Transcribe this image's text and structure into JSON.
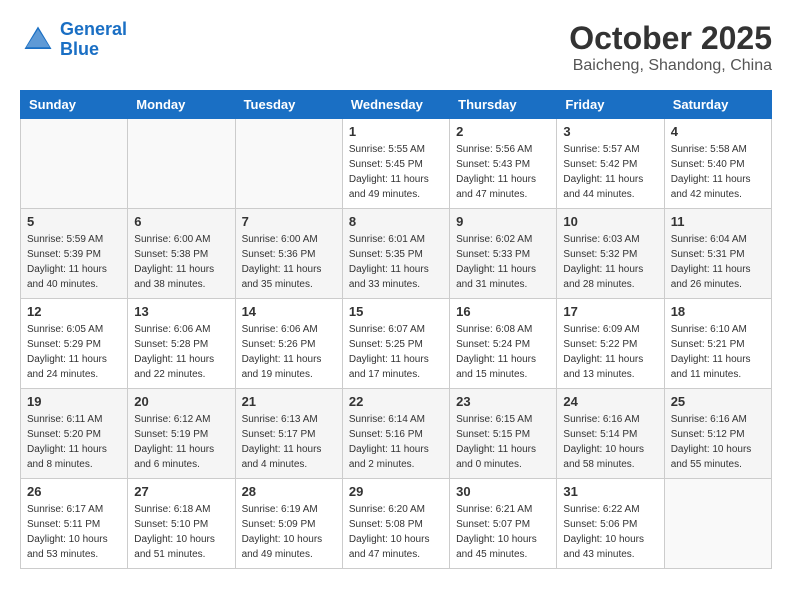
{
  "header": {
    "logo_line1": "General",
    "logo_line2": "Blue",
    "month": "October 2025",
    "location": "Baicheng, Shandong, China"
  },
  "weekdays": [
    "Sunday",
    "Monday",
    "Tuesday",
    "Wednesday",
    "Thursday",
    "Friday",
    "Saturday"
  ],
  "weeks": [
    [
      {
        "day": "",
        "info": ""
      },
      {
        "day": "",
        "info": ""
      },
      {
        "day": "",
        "info": ""
      },
      {
        "day": "1",
        "info": "Sunrise: 5:55 AM\nSunset: 5:45 PM\nDaylight: 11 hours\nand 49 minutes."
      },
      {
        "day": "2",
        "info": "Sunrise: 5:56 AM\nSunset: 5:43 PM\nDaylight: 11 hours\nand 47 minutes."
      },
      {
        "day": "3",
        "info": "Sunrise: 5:57 AM\nSunset: 5:42 PM\nDaylight: 11 hours\nand 44 minutes."
      },
      {
        "day": "4",
        "info": "Sunrise: 5:58 AM\nSunset: 5:40 PM\nDaylight: 11 hours\nand 42 minutes."
      }
    ],
    [
      {
        "day": "5",
        "info": "Sunrise: 5:59 AM\nSunset: 5:39 PM\nDaylight: 11 hours\nand 40 minutes."
      },
      {
        "day": "6",
        "info": "Sunrise: 6:00 AM\nSunset: 5:38 PM\nDaylight: 11 hours\nand 38 minutes."
      },
      {
        "day": "7",
        "info": "Sunrise: 6:00 AM\nSunset: 5:36 PM\nDaylight: 11 hours\nand 35 minutes."
      },
      {
        "day": "8",
        "info": "Sunrise: 6:01 AM\nSunset: 5:35 PM\nDaylight: 11 hours\nand 33 minutes."
      },
      {
        "day": "9",
        "info": "Sunrise: 6:02 AM\nSunset: 5:33 PM\nDaylight: 11 hours\nand 31 minutes."
      },
      {
        "day": "10",
        "info": "Sunrise: 6:03 AM\nSunset: 5:32 PM\nDaylight: 11 hours\nand 28 minutes."
      },
      {
        "day": "11",
        "info": "Sunrise: 6:04 AM\nSunset: 5:31 PM\nDaylight: 11 hours\nand 26 minutes."
      }
    ],
    [
      {
        "day": "12",
        "info": "Sunrise: 6:05 AM\nSunset: 5:29 PM\nDaylight: 11 hours\nand 24 minutes."
      },
      {
        "day": "13",
        "info": "Sunrise: 6:06 AM\nSunset: 5:28 PM\nDaylight: 11 hours\nand 22 minutes."
      },
      {
        "day": "14",
        "info": "Sunrise: 6:06 AM\nSunset: 5:26 PM\nDaylight: 11 hours\nand 19 minutes."
      },
      {
        "day": "15",
        "info": "Sunrise: 6:07 AM\nSunset: 5:25 PM\nDaylight: 11 hours\nand 17 minutes."
      },
      {
        "day": "16",
        "info": "Sunrise: 6:08 AM\nSunset: 5:24 PM\nDaylight: 11 hours\nand 15 minutes."
      },
      {
        "day": "17",
        "info": "Sunrise: 6:09 AM\nSunset: 5:22 PM\nDaylight: 11 hours\nand 13 minutes."
      },
      {
        "day": "18",
        "info": "Sunrise: 6:10 AM\nSunset: 5:21 PM\nDaylight: 11 hours\nand 11 minutes."
      }
    ],
    [
      {
        "day": "19",
        "info": "Sunrise: 6:11 AM\nSunset: 5:20 PM\nDaylight: 11 hours\nand 8 minutes."
      },
      {
        "day": "20",
        "info": "Sunrise: 6:12 AM\nSunset: 5:19 PM\nDaylight: 11 hours\nand 6 minutes."
      },
      {
        "day": "21",
        "info": "Sunrise: 6:13 AM\nSunset: 5:17 PM\nDaylight: 11 hours\nand 4 minutes."
      },
      {
        "day": "22",
        "info": "Sunrise: 6:14 AM\nSunset: 5:16 PM\nDaylight: 11 hours\nand 2 minutes."
      },
      {
        "day": "23",
        "info": "Sunrise: 6:15 AM\nSunset: 5:15 PM\nDaylight: 11 hours\nand 0 minutes."
      },
      {
        "day": "24",
        "info": "Sunrise: 6:16 AM\nSunset: 5:14 PM\nDaylight: 10 hours\nand 58 minutes."
      },
      {
        "day": "25",
        "info": "Sunrise: 6:16 AM\nSunset: 5:12 PM\nDaylight: 10 hours\nand 55 minutes."
      }
    ],
    [
      {
        "day": "26",
        "info": "Sunrise: 6:17 AM\nSunset: 5:11 PM\nDaylight: 10 hours\nand 53 minutes."
      },
      {
        "day": "27",
        "info": "Sunrise: 6:18 AM\nSunset: 5:10 PM\nDaylight: 10 hours\nand 51 minutes."
      },
      {
        "day": "28",
        "info": "Sunrise: 6:19 AM\nSunset: 5:09 PM\nDaylight: 10 hours\nand 49 minutes."
      },
      {
        "day": "29",
        "info": "Sunrise: 6:20 AM\nSunset: 5:08 PM\nDaylight: 10 hours\nand 47 minutes."
      },
      {
        "day": "30",
        "info": "Sunrise: 6:21 AM\nSunset: 5:07 PM\nDaylight: 10 hours\nand 45 minutes."
      },
      {
        "day": "31",
        "info": "Sunrise: 6:22 AM\nSunset: 5:06 PM\nDaylight: 10 hours\nand 43 minutes."
      },
      {
        "day": "",
        "info": ""
      }
    ]
  ]
}
